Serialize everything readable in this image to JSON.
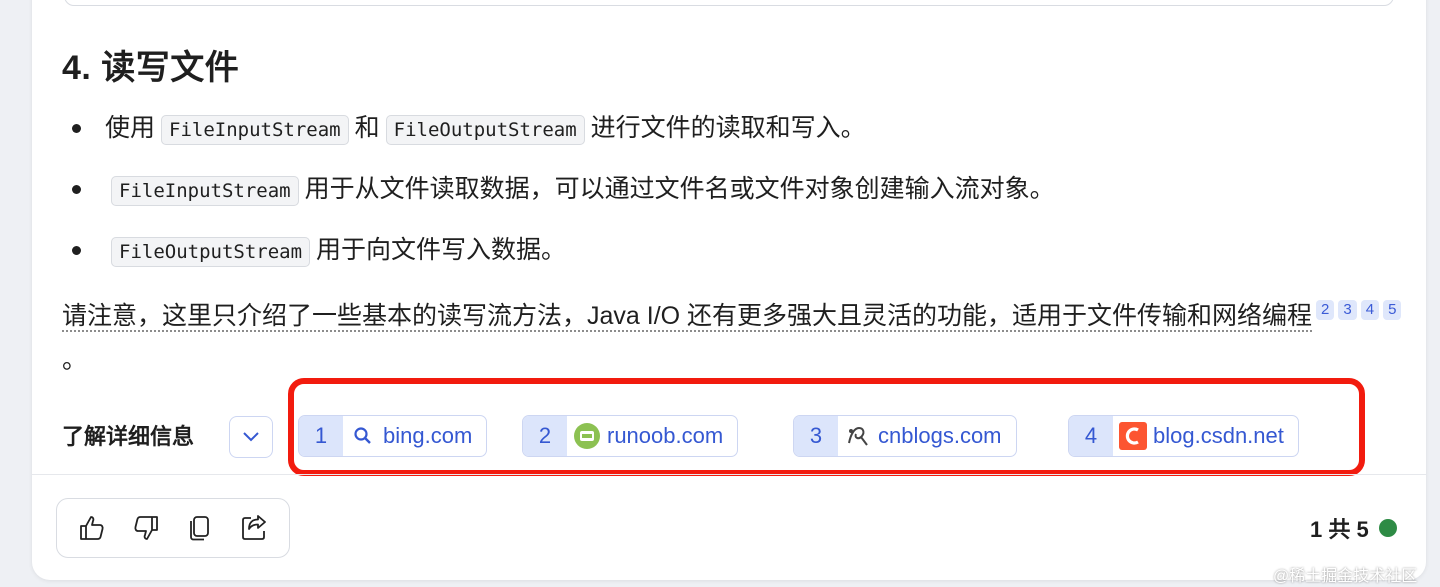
{
  "section": {
    "heading": "4. 读写文件"
  },
  "bullets": [
    {
      "parts": [
        "使用",
        "FileInputStream",
        "和",
        "FileOutputStream",
        "进行文件的读取和写入。"
      ]
    },
    {
      "code": "FileInputStream",
      "text": "用于从文件读取数据，可以通过文件名或文件对象创建输入流对象。"
    },
    {
      "code": "FileOutputStream",
      "text": "用于向文件写入数据。"
    }
  ],
  "note": {
    "text": "请注意，这里只介绍了一些基本的读写流方法，Java I/O 还有更多强大且灵活的功能，适用于文件传输和网络编程",
    "citations": [
      "2",
      "3",
      "4",
      "5"
    ],
    "end": "。"
  },
  "learn_more": {
    "label": "了解详细信息",
    "expand_icon": "chevron-down-icon",
    "sources": [
      {
        "num": "1",
        "host": "bing.com",
        "icon": "search-icon"
      },
      {
        "num": "2",
        "host": "runoob.com",
        "icon": "runoob-icon"
      },
      {
        "num": "3",
        "host": "cnblogs.com",
        "icon": "cnblogs-icon"
      },
      {
        "num": "4",
        "host": "blog.csdn.net",
        "icon": "csdn-icon"
      }
    ]
  },
  "actions": [
    "thumbs-up-icon",
    "thumbs-down-icon",
    "copy-icon",
    "share-icon"
  ],
  "pager": {
    "label": "1 共 5",
    "status_color": "#2e8b45"
  },
  "watermark": "@稀土掘金技术社区",
  "colors": {
    "accent": "#3558d2",
    "chip_bg": "#dce5fb",
    "highlight": "#f21b0e"
  }
}
